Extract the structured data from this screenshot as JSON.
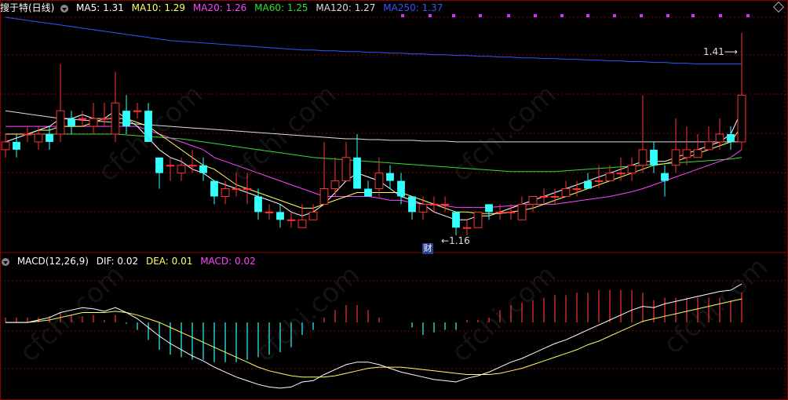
{
  "header": {
    "stock_name": "搜于特(日线)",
    "ma_labels": [
      {
        "text": "MA5: 1.31",
        "color": "#ffffff"
      },
      {
        "text": "MA10: 1.29",
        "color": "#ffff66"
      },
      {
        "text": "MA20: 1.26",
        "color": "#ff44ff"
      },
      {
        "text": "MA60: 1.25",
        "color": "#33dd33"
      },
      {
        "text": "MA120: 1.27",
        "color": "#dddddd"
      },
      {
        "text": "MA250: 1.37",
        "color": "#3355ff"
      }
    ]
  },
  "macd_header": {
    "name": "MACD(12,26,9)",
    "dif": "DIF: 0.02",
    "dea": "DEA: 0.01",
    "macd": "MACD: 0.02"
  },
  "annotations": {
    "high_label": "1.41",
    "low_label": "1.16",
    "finance_badge": "财"
  },
  "watermark": "cfchi.com",
  "colors": {
    "up": "#ff3333",
    "down": "#33ffff",
    "ma5": "#ffffff",
    "ma10": "#ffff66",
    "ma20": "#ff44ff",
    "ma60": "#33dd33",
    "ma120": "#dddddd",
    "ma250": "#3355ff",
    "grid": "#8b0000",
    "dif": "#ffffff",
    "dea": "#ffff66"
  },
  "chart_data": [
    {
      "type": "candlestick",
      "title": "搜于特(日线)",
      "ylim": [
        1.13,
        1.43
      ],
      "candles": [
        [
          1.26,
          1.27,
          1.28,
          1.25
        ],
        [
          1.27,
          1.26,
          1.28,
          1.25
        ],
        [
          1.28,
          1.28,
          1.29,
          1.27
        ],
        [
          1.27,
          1.28,
          1.29,
          1.26
        ],
        [
          1.28,
          1.27,
          1.29,
          1.26
        ],
        [
          1.28,
          1.31,
          1.37,
          1.27
        ],
        [
          1.3,
          1.29,
          1.31,
          1.28
        ],
        [
          1.3,
          1.3,
          1.31,
          1.29
        ],
        [
          1.29,
          1.3,
          1.32,
          1.28
        ],
        [
          1.3,
          1.3,
          1.32,
          1.29
        ],
        [
          1.28,
          1.32,
          1.36,
          1.27
        ],
        [
          1.31,
          1.29,
          1.33,
          1.28
        ],
        [
          1.31,
          1.31,
          1.32,
          1.3
        ],
        [
          1.31,
          1.27,
          1.32,
          1.27
        ],
        [
          1.25,
          1.23,
          1.25,
          1.21
        ],
        [
          1.24,
          1.24,
          1.25,
          1.22
        ],
        [
          1.23,
          1.24,
          1.25,
          1.22
        ],
        [
          1.24,
          1.24,
          1.26,
          1.23
        ],
        [
          1.24,
          1.23,
          1.25,
          1.22
        ],
        [
          1.22,
          1.2,
          1.22,
          1.19
        ],
        [
          1.2,
          1.21,
          1.22,
          1.19
        ],
        [
          1.21,
          1.21,
          1.23,
          1.2
        ],
        [
          1.21,
          1.21,
          1.23,
          1.19
        ],
        [
          1.2,
          1.18,
          1.21,
          1.17
        ],
        [
          1.18,
          1.18,
          1.19,
          1.17
        ],
        [
          1.18,
          1.17,
          1.19,
          1.16
        ],
        [
          1.17,
          1.17,
          1.18,
          1.16
        ],
        [
          1.16,
          1.17,
          1.19,
          1.16
        ],
        [
          1.17,
          1.18,
          1.19,
          1.17
        ],
        [
          1.19,
          1.21,
          1.27,
          1.19
        ],
        [
          1.21,
          1.22,
          1.25,
          1.2
        ],
        [
          1.22,
          1.25,
          1.27,
          1.22
        ],
        [
          1.25,
          1.21,
          1.28,
          1.21
        ],
        [
          1.21,
          1.2,
          1.22,
          1.2
        ],
        [
          1.21,
          1.23,
          1.25,
          1.2
        ],
        [
          1.23,
          1.22,
          1.24,
          1.21
        ],
        [
          1.22,
          1.2,
          1.23,
          1.19
        ],
        [
          1.2,
          1.18,
          1.2,
          1.17
        ],
        [
          1.18,
          1.19,
          1.2,
          1.17
        ],
        [
          1.19,
          1.19,
          1.2,
          1.18
        ],
        [
          1.19,
          1.19,
          1.2,
          1.18
        ],
        [
          1.18,
          1.16,
          1.18,
          1.15
        ],
        [
          1.16,
          1.16,
          1.17,
          1.15
        ],
        [
          1.16,
          1.18,
          1.18,
          1.16
        ],
        [
          1.19,
          1.18,
          1.19,
          1.17
        ],
        [
          1.18,
          1.18,
          1.19,
          1.17
        ],
        [
          1.18,
          1.18,
          1.19,
          1.17
        ],
        [
          1.17,
          1.19,
          1.2,
          1.17
        ],
        [
          1.19,
          1.2,
          1.2,
          1.18
        ],
        [
          1.2,
          1.2,
          1.21,
          1.19
        ],
        [
          1.2,
          1.2,
          1.21,
          1.19
        ],
        [
          1.2,
          1.21,
          1.22,
          1.2
        ],
        [
          1.21,
          1.21,
          1.22,
          1.2
        ],
        [
          1.22,
          1.21,
          1.23,
          1.21
        ],
        [
          1.22,
          1.22,
          1.24,
          1.21
        ],
        [
          1.22,
          1.23,
          1.24,
          1.22
        ],
        [
          1.23,
          1.23,
          1.25,
          1.22
        ],
        [
          1.23,
          1.24,
          1.25,
          1.22
        ],
        [
          1.24,
          1.26,
          1.33,
          1.23
        ],
        [
          1.26,
          1.24,
          1.27,
          1.23
        ],
        [
          1.23,
          1.22,
          1.24,
          1.2
        ],
        [
          1.24,
          1.26,
          1.3,
          1.23
        ],
        [
          1.25,
          1.26,
          1.29,
          1.24
        ],
        [
          1.25,
          1.26,
          1.28,
          1.25
        ],
        [
          1.26,
          1.27,
          1.29,
          1.26
        ],
        [
          1.27,
          1.28,
          1.3,
          1.26
        ],
        [
          1.28,
          1.27,
          1.29,
          1.26
        ],
        [
          1.27,
          1.33,
          1.41,
          1.26
        ]
      ],
      "ma5": [
        1.27,
        1.275,
        1.28,
        1.285,
        1.29,
        1.3,
        1.3,
        1.305,
        1.3,
        1.3,
        1.31,
        1.3,
        1.29,
        1.275,
        1.26,
        1.25,
        1.245,
        1.235,
        1.23,
        1.22,
        1.215,
        1.21,
        1.205,
        1.2,
        1.195,
        1.19,
        1.18,
        1.175,
        1.18,
        1.19,
        1.205,
        1.22,
        1.23,
        1.225,
        1.22,
        1.21,
        1.2,
        1.195,
        1.19,
        1.18,
        1.175,
        1.17,
        1.17,
        1.175,
        1.175,
        1.18,
        1.185,
        1.19,
        1.195,
        1.2,
        1.205,
        1.21,
        1.215,
        1.22,
        1.225,
        1.23,
        1.235,
        1.24,
        1.245,
        1.245,
        1.245,
        1.25,
        1.255,
        1.26,
        1.265,
        1.27,
        1.28,
        1.31
      ],
      "ma10": [
        1.28,
        1.28,
        1.28,
        1.285,
        1.285,
        1.29,
        1.29,
        1.29,
        1.295,
        1.3,
        1.3,
        1.3,
        1.295,
        1.29,
        1.28,
        1.27,
        1.26,
        1.25,
        1.24,
        1.235,
        1.225,
        1.215,
        1.21,
        1.205,
        1.2,
        1.195,
        1.19,
        1.185,
        1.185,
        1.19,
        1.195,
        1.2,
        1.205,
        1.205,
        1.205,
        1.205,
        1.205,
        1.2,
        1.195,
        1.19,
        1.185,
        1.18,
        1.18,
        1.178,
        1.178,
        1.178,
        1.18,
        1.182,
        1.185,
        1.19,
        1.195,
        1.2,
        1.205,
        1.21,
        1.215,
        1.22,
        1.225,
        1.23,
        1.235,
        1.24,
        1.242,
        1.245,
        1.25,
        1.255,
        1.26,
        1.265,
        1.27,
        1.29
      ],
      "ma20": [
        1.29,
        1.29,
        1.29,
        1.29,
        1.29,
        1.29,
        1.29,
        1.29,
        1.29,
        1.29,
        1.29,
        1.29,
        1.29,
        1.285,
        1.28,
        1.275,
        1.27,
        1.265,
        1.26,
        1.25,
        1.245,
        1.24,
        1.235,
        1.23,
        1.225,
        1.22,
        1.215,
        1.21,
        1.205,
        1.2,
        1.2,
        1.2,
        1.2,
        1.2,
        1.198,
        1.195,
        1.195,
        1.192,
        1.19,
        1.19,
        1.188,
        1.186,
        1.186,
        1.186,
        1.186,
        1.187,
        1.188,
        1.189,
        1.19,
        1.19,
        1.19,
        1.192,
        1.194,
        1.196,
        1.198,
        1.2,
        1.203,
        1.206,
        1.21,
        1.215,
        1.22,
        1.225,
        1.23,
        1.235,
        1.24,
        1.245,
        1.25,
        1.26
      ],
      "ma60": [
        1.28,
        1.28,
        1.28,
        1.28,
        1.28,
        1.28,
        1.28,
        1.28,
        1.28,
        1.28,
        1.28,
        1.279,
        1.278,
        1.277,
        1.276,
        1.275,
        1.274,
        1.272,
        1.27,
        1.268,
        1.266,
        1.264,
        1.262,
        1.26,
        1.258,
        1.256,
        1.254,
        1.252,
        1.25,
        1.249,
        1.248,
        1.247,
        1.246,
        1.245,
        1.244,
        1.243,
        1.242,
        1.241,
        1.24,
        1.239,
        1.238,
        1.237,
        1.236,
        1.235,
        1.234,
        1.233,
        1.232,
        1.232,
        1.232,
        1.232,
        1.232,
        1.233,
        1.234,
        1.235,
        1.236,
        1.237,
        1.238,
        1.239,
        1.24,
        1.241,
        1.242,
        1.243,
        1.244,
        1.245,
        1.246,
        1.247,
        1.248,
        1.25
      ],
      "ma120": [
        1.31,
        1.308,
        1.306,
        1.304,
        1.302,
        1.3,
        1.299,
        1.298,
        1.297,
        1.296,
        1.295,
        1.294,
        1.293,
        1.292,
        1.291,
        1.29,
        1.289,
        1.288,
        1.287,
        1.286,
        1.285,
        1.284,
        1.283,
        1.282,
        1.281,
        1.28,
        1.279,
        1.278,
        1.277,
        1.276,
        1.275,
        1.274,
        1.274,
        1.273,
        1.273,
        1.272,
        1.272,
        1.272,
        1.271,
        1.271,
        1.271,
        1.27,
        1.27,
        1.27,
        1.27,
        1.27,
        1.27,
        1.27,
        1.27,
        1.27,
        1.27,
        1.27,
        1.27,
        1.27,
        1.27,
        1.27,
        1.27,
        1.27,
        1.27,
        1.27,
        1.27,
        1.27,
        1.27,
        1.27,
        1.27,
        1.27,
        1.27,
        1.27
      ],
      "ma250": [
        1.43,
        1.428,
        1.426,
        1.424,
        1.422,
        1.42,
        1.418,
        1.416,
        1.414,
        1.412,
        1.41,
        1.408,
        1.406,
        1.404,
        1.402,
        1.4,
        1.399,
        1.398,
        1.397,
        1.396,
        1.395,
        1.394,
        1.393,
        1.392,
        1.391,
        1.39,
        1.389,
        1.388,
        1.388,
        1.387,
        1.387,
        1.386,
        1.386,
        1.385,
        1.385,
        1.384,
        1.384,
        1.383,
        1.383,
        1.382,
        1.382,
        1.381,
        1.381,
        1.38,
        1.38,
        1.379,
        1.379,
        1.378,
        1.378,
        1.377,
        1.377,
        1.376,
        1.376,
        1.375,
        1.375,
        1.374,
        1.374,
        1.373,
        1.373,
        1.372,
        1.372,
        1.371,
        1.371,
        1.37,
        1.37,
        1.37,
        1.37,
        1.37
      ]
    },
    {
      "type": "macd",
      "title": "MACD(12,26,9)",
      "ylim": [
        -0.06,
        0.045
      ],
      "dif": [
        0.0,
        0.0,
        0.0,
        0.002,
        0.004,
        0.008,
        0.01,
        0.012,
        0.011,
        0.009,
        0.012,
        0.008,
        0.003,
        -0.004,
        -0.011,
        -0.017,
        -0.022,
        -0.027,
        -0.031,
        -0.036,
        -0.04,
        -0.044,
        -0.047,
        -0.05,
        -0.052,
        -0.053,
        -0.052,
        -0.048,
        -0.047,
        -0.042,
        -0.038,
        -0.034,
        -0.032,
        -0.032,
        -0.034,
        -0.037,
        -0.04,
        -0.042,
        -0.044,
        -0.046,
        -0.047,
        -0.048,
        -0.045,
        -0.043,
        -0.04,
        -0.036,
        -0.032,
        -0.029,
        -0.025,
        -0.021,
        -0.017,
        -0.014,
        -0.01,
        -0.006,
        -0.002,
        0.002,
        0.006,
        0.01,
        0.013,
        0.012,
        0.015,
        0.017,
        0.019,
        0.021,
        0.023,
        0.025,
        0.026,
        0.031
      ],
      "dea": [
        0.0,
        0.0,
        0.0,
        0.001,
        0.002,
        0.004,
        0.006,
        0.008,
        0.008,
        0.008,
        0.009,
        0.008,
        0.006,
        0.003,
        0.0,
        -0.004,
        -0.008,
        -0.012,
        -0.016,
        -0.02,
        -0.024,
        -0.028,
        -0.032,
        -0.036,
        -0.039,
        -0.041,
        -0.043,
        -0.044,
        -0.044,
        -0.044,
        -0.043,
        -0.041,
        -0.039,
        -0.037,
        -0.036,
        -0.036,
        -0.036,
        -0.037,
        -0.038,
        -0.039,
        -0.04,
        -0.041,
        -0.042,
        -0.042,
        -0.042,
        -0.041,
        -0.039,
        -0.037,
        -0.034,
        -0.031,
        -0.028,
        -0.025,
        -0.022,
        -0.018,
        -0.015,
        -0.011,
        -0.007,
        -0.003,
        0.001,
        0.003,
        0.005,
        0.007,
        0.009,
        0.011,
        0.013,
        0.015,
        0.017,
        0.019
      ],
      "macd": [
        0.004,
        0.004,
        0.004,
        0.004,
        0.005,
        0.008,
        0.006,
        0.005,
        0.006,
        0.002,
        0.006,
        -0.001,
        -0.006,
        -0.014,
        -0.022,
        -0.026,
        -0.028,
        -0.03,
        -0.03,
        -0.032,
        -0.032,
        -0.032,
        -0.03,
        -0.028,
        -0.026,
        -0.024,
        -0.02,
        -0.01,
        -0.006,
        0.004,
        0.01,
        0.014,
        0.014,
        0.01,
        0.004,
        0.0,
        0.0,
        -0.004,
        -0.01,
        -0.008,
        -0.006,
        -0.006,
        0.002,
        0.002,
        0.004,
        0.01,
        0.014,
        0.016,
        0.018,
        0.02,
        0.022,
        0.022,
        0.024,
        0.024,
        0.026,
        0.026,
        0.026,
        0.026,
        0.024,
        0.018,
        0.02,
        0.02,
        0.02,
        0.02,
        0.02,
        0.02,
        0.018,
        0.024
      ]
    }
  ]
}
